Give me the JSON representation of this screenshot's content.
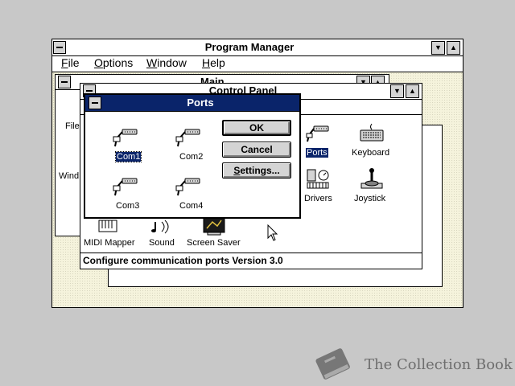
{
  "program_manager": {
    "title": "Program Manager",
    "menu": [
      {
        "label": "File",
        "accel": "F"
      },
      {
        "label": "Options",
        "accel": "O"
      },
      {
        "label": "Window",
        "accel": "W"
      },
      {
        "label": "Help",
        "accel": "H"
      }
    ],
    "main_group_title": "Main",
    "main_group_partial_labels": [
      "File",
      "Wind"
    ]
  },
  "control_panel": {
    "title": "Control Panel",
    "icons": [
      {
        "label": "Ports",
        "icon": "ports-icon",
        "selected": true
      },
      {
        "label": "Keyboard",
        "icon": "keyboard-icon"
      },
      {
        "label": "Drivers",
        "icon": "drivers-icon"
      },
      {
        "label": "Joystick",
        "icon": "joystick-icon"
      },
      {
        "label": "MIDI Mapper",
        "icon": "midi-mapper-icon"
      },
      {
        "label": "Sound",
        "icon": "sound-icon"
      },
      {
        "label": "Screen Saver",
        "icon": "screen-saver-icon"
      }
    ],
    "status": "Configure communication ports Version 3.0"
  },
  "ports_dialog": {
    "title": "Ports",
    "ports": [
      {
        "label": "Com1",
        "selected": true
      },
      {
        "label": "Com2"
      },
      {
        "label": "Com3"
      },
      {
        "label": "Com4"
      }
    ],
    "buttons": {
      "ok": "OK",
      "cancel": "Cancel",
      "settings": "Settings..."
    }
  },
  "watermark": {
    "text": "The Collection Book"
  },
  "colors": {
    "desktop": "#c8c8c8",
    "active_title": "#0a246a",
    "workspace": "#f5f3dc",
    "selection": "#0a246a"
  }
}
